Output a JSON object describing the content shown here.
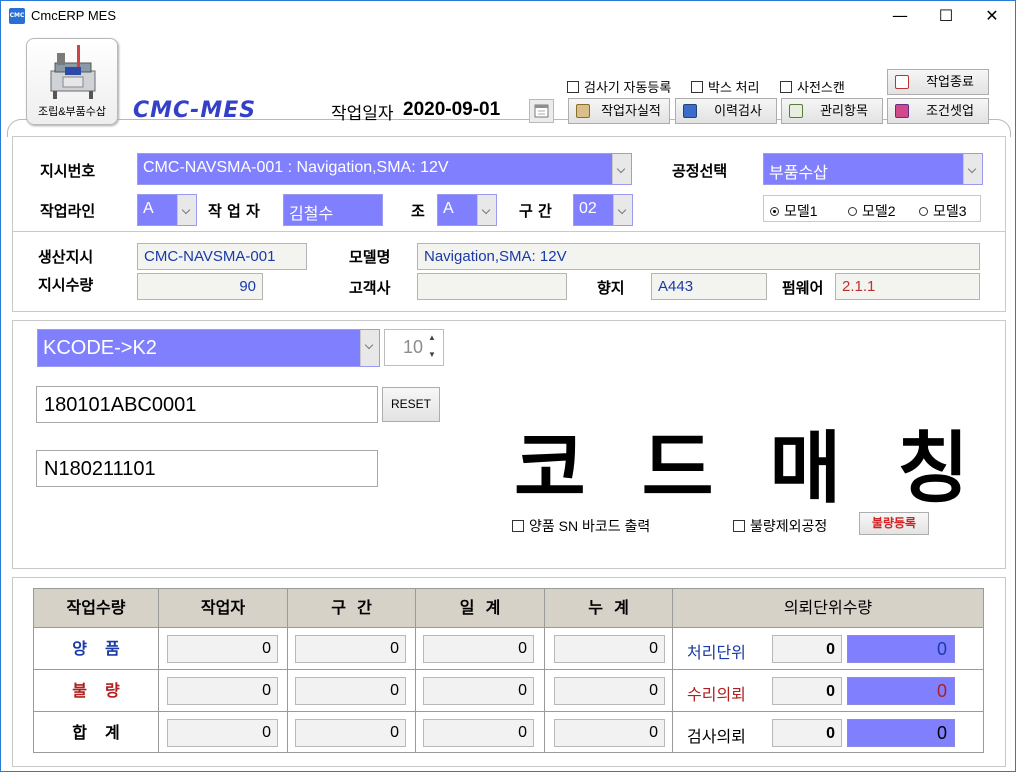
{
  "window": {
    "title": "CmcERP   MES",
    "app_icon": "cmc-app-icon",
    "controls": [
      "minimize-icon",
      "maximize-icon",
      "close-icon"
    ]
  },
  "header": {
    "module_button_label": "조립&부품수삽",
    "brand": "CMC-MES",
    "date_label": "작업일자",
    "date_value": "2020-09-01",
    "checkboxes": [
      {
        "label": "검사기 자동등록",
        "checked": false
      },
      {
        "label": "박스 처리",
        "checked": false
      },
      {
        "label": "사전스캔",
        "checked": false
      }
    ],
    "buttons": {
      "work_end": "작업종료",
      "worker_record": "작업자실적",
      "history_check": "이력검사",
      "management": "관리항목",
      "condition_setup": "조건셋업"
    }
  },
  "order": {
    "order_no_label": "지시번호",
    "order_no_value": "CMC-NAVSMA-001 : Navigation,SMA: 12V",
    "process_label": "공정선택",
    "process_value": "부품수삽",
    "line_label": "작업라인",
    "line_value": "A",
    "worker_label": "작 업 자",
    "worker_value": "김철수",
    "shift_label": "조",
    "shift_value": "A",
    "section_label": "구 간",
    "section_value": "02",
    "models": [
      {
        "label": "모델1",
        "selected": true
      },
      {
        "label": "모델2",
        "selected": false
      },
      {
        "label": "모델3",
        "selected": false
      }
    ]
  },
  "production": {
    "instruction_label": "생산지시",
    "instruction_value": "CMC-NAVSMA-001",
    "model_label": "모델명",
    "model_value": "Navigation,SMA: 12V",
    "qty_label": "지시수량",
    "qty_value": "90",
    "customer_label": "고객사",
    "customer_value": "",
    "destination_label": "향지",
    "destination_value": "A443",
    "firmware_label": "펌웨어",
    "firmware_value": "2.1.1"
  },
  "matching": {
    "kcode_value": "KCODE->K2",
    "spin_value": "10",
    "input1_value": "180101ABC0001",
    "reset_label": "RESET",
    "input2_value": "N180211101",
    "big_title": "코드매칭",
    "chk_good_sn": "양품 SN 바코드 출력",
    "chk_defect_exclude": "불량제외공정",
    "defect_register": "불량등록"
  },
  "grid": {
    "headers": [
      "작업수량",
      "작업자",
      "구  간",
      "일  계",
      "누  계",
      "의뢰단위수량"
    ],
    "rows": [
      {
        "label": "양품",
        "values": [
          "0",
          "0",
          "0",
          "0"
        ],
        "req_label": "처리단위",
        "req_num": "0",
        "req_blue": "0",
        "color": "#1a3aa6",
        "req_color": "#1a3aa6"
      },
      {
        "label": "불량",
        "values": [
          "0",
          "0",
          "0",
          "0"
        ],
        "req_label": "수리의뢰",
        "req_num": "0",
        "req_blue": "0",
        "color": "#b01e1e",
        "req_color": "#b01e1e"
      },
      {
        "label": "합계",
        "values": [
          "0",
          "0",
          "0",
          "0"
        ],
        "req_label": "검사의뢰",
        "req_num": "0",
        "req_blue": "0",
        "color": "#000000",
        "req_color": "#000000"
      }
    ]
  }
}
